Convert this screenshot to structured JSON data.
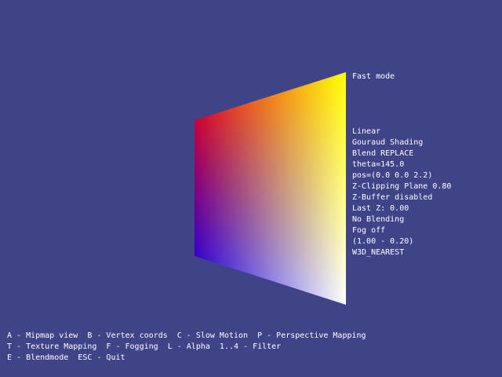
{
  "scene": {
    "background": "#3f4489",
    "quad_corner_colors": {
      "top_left": "#ff0000",
      "top_right": "#ffff00",
      "bottom_left": "#0000ff",
      "bottom_right": "#ffffff"
    }
  },
  "mode_label": "Fast mode",
  "status_lines": [
    "Linear",
    "Gouraud Shading",
    "Blend REPLACE",
    "theta=145.0",
    "pos=(0.0 0.0 2.2)",
    "Z-Clipping Plane 0.80",
    "Z-Buffer disabled",
    "Last Z: 0.00",
    "No Blending",
    "Fog off",
    "(1.00 - 0.20)",
    "W3D_NEAREST"
  ],
  "help_lines": [
    "A - Mipmap view  B - Vertex coords  C - Slow Motion  P - Perspective Mapping",
    "T - Texture Mapping  F - Fogging  L - Alpha  1..4 - Filter",
    "E - Blendmode  ESC - Quit"
  ]
}
